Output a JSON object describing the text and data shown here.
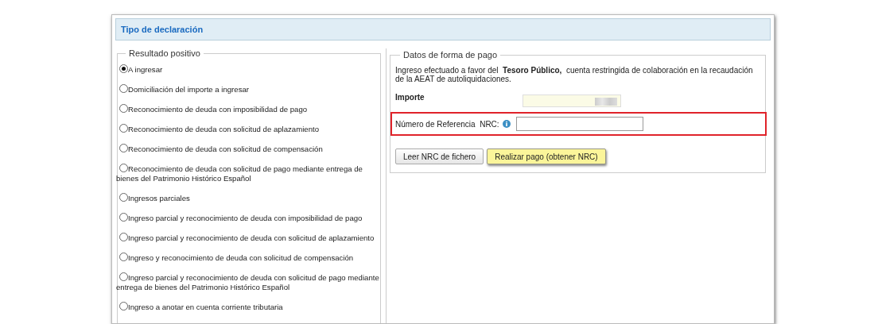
{
  "panel": {
    "title": "Tipo de declaración"
  },
  "result_group": {
    "legend": "Resultado positivo",
    "options": [
      {
        "label": "A ingresar",
        "selected": true
      },
      {
        "label": "Domiciliación del importe a ingresar",
        "selected": false
      },
      {
        "label": "Reconocimiento de deuda con imposibilidad de pago",
        "selected": false
      },
      {
        "label": "Reconocimiento de deuda con solicitud de aplazamiento",
        "selected": false
      },
      {
        "label": "Reconocimiento de deuda con solicitud de compensación",
        "selected": false
      },
      {
        "label": "Reconocimiento de deuda con solicitud de pago mediante entrega de bienes del Patrimonio Histórico Español",
        "selected": false
      },
      {
        "label": "Ingresos parciales",
        "selected": false
      },
      {
        "label": "Ingreso parcial y reconocimiento de deuda con imposibilidad de pago",
        "selected": false
      },
      {
        "label": "Ingreso parcial y reconocimiento de deuda con solicitud de aplazamiento",
        "selected": false
      },
      {
        "label": "Ingreso y reconocimiento de deuda con solicitud de compensación",
        "selected": false
      },
      {
        "label": "Ingreso parcial y reconocimiento de deuda con solicitud de pago mediante entrega de bienes del Patrimonio Histórico Español",
        "selected": false
      },
      {
        "label": "Ingreso a anotar en cuenta corriente tributaria",
        "selected": false
      }
    ]
  },
  "payment_group": {
    "legend": "Datos de forma de pago",
    "description": "Ingreso efectuado a favor del  **Tesoro Público,**  cuenta restringida de colaboración en la recaudación de la AEAT de autoliquidaciones.",
    "fields": [
      {
        "kind": "amount",
        "label": "Importe",
        "highlighted": false
      },
      {
        "kind": "nrc",
        "label": "Número de Referencia  NRC:",
        "highlighted": true
      }
    ],
    "buttons": [
      {
        "label": "Leer NRC de fichero",
        "primary": false
      },
      {
        "label": "Realizar pago (obtener NRC)",
        "primary": true
      }
    ]
  }
}
